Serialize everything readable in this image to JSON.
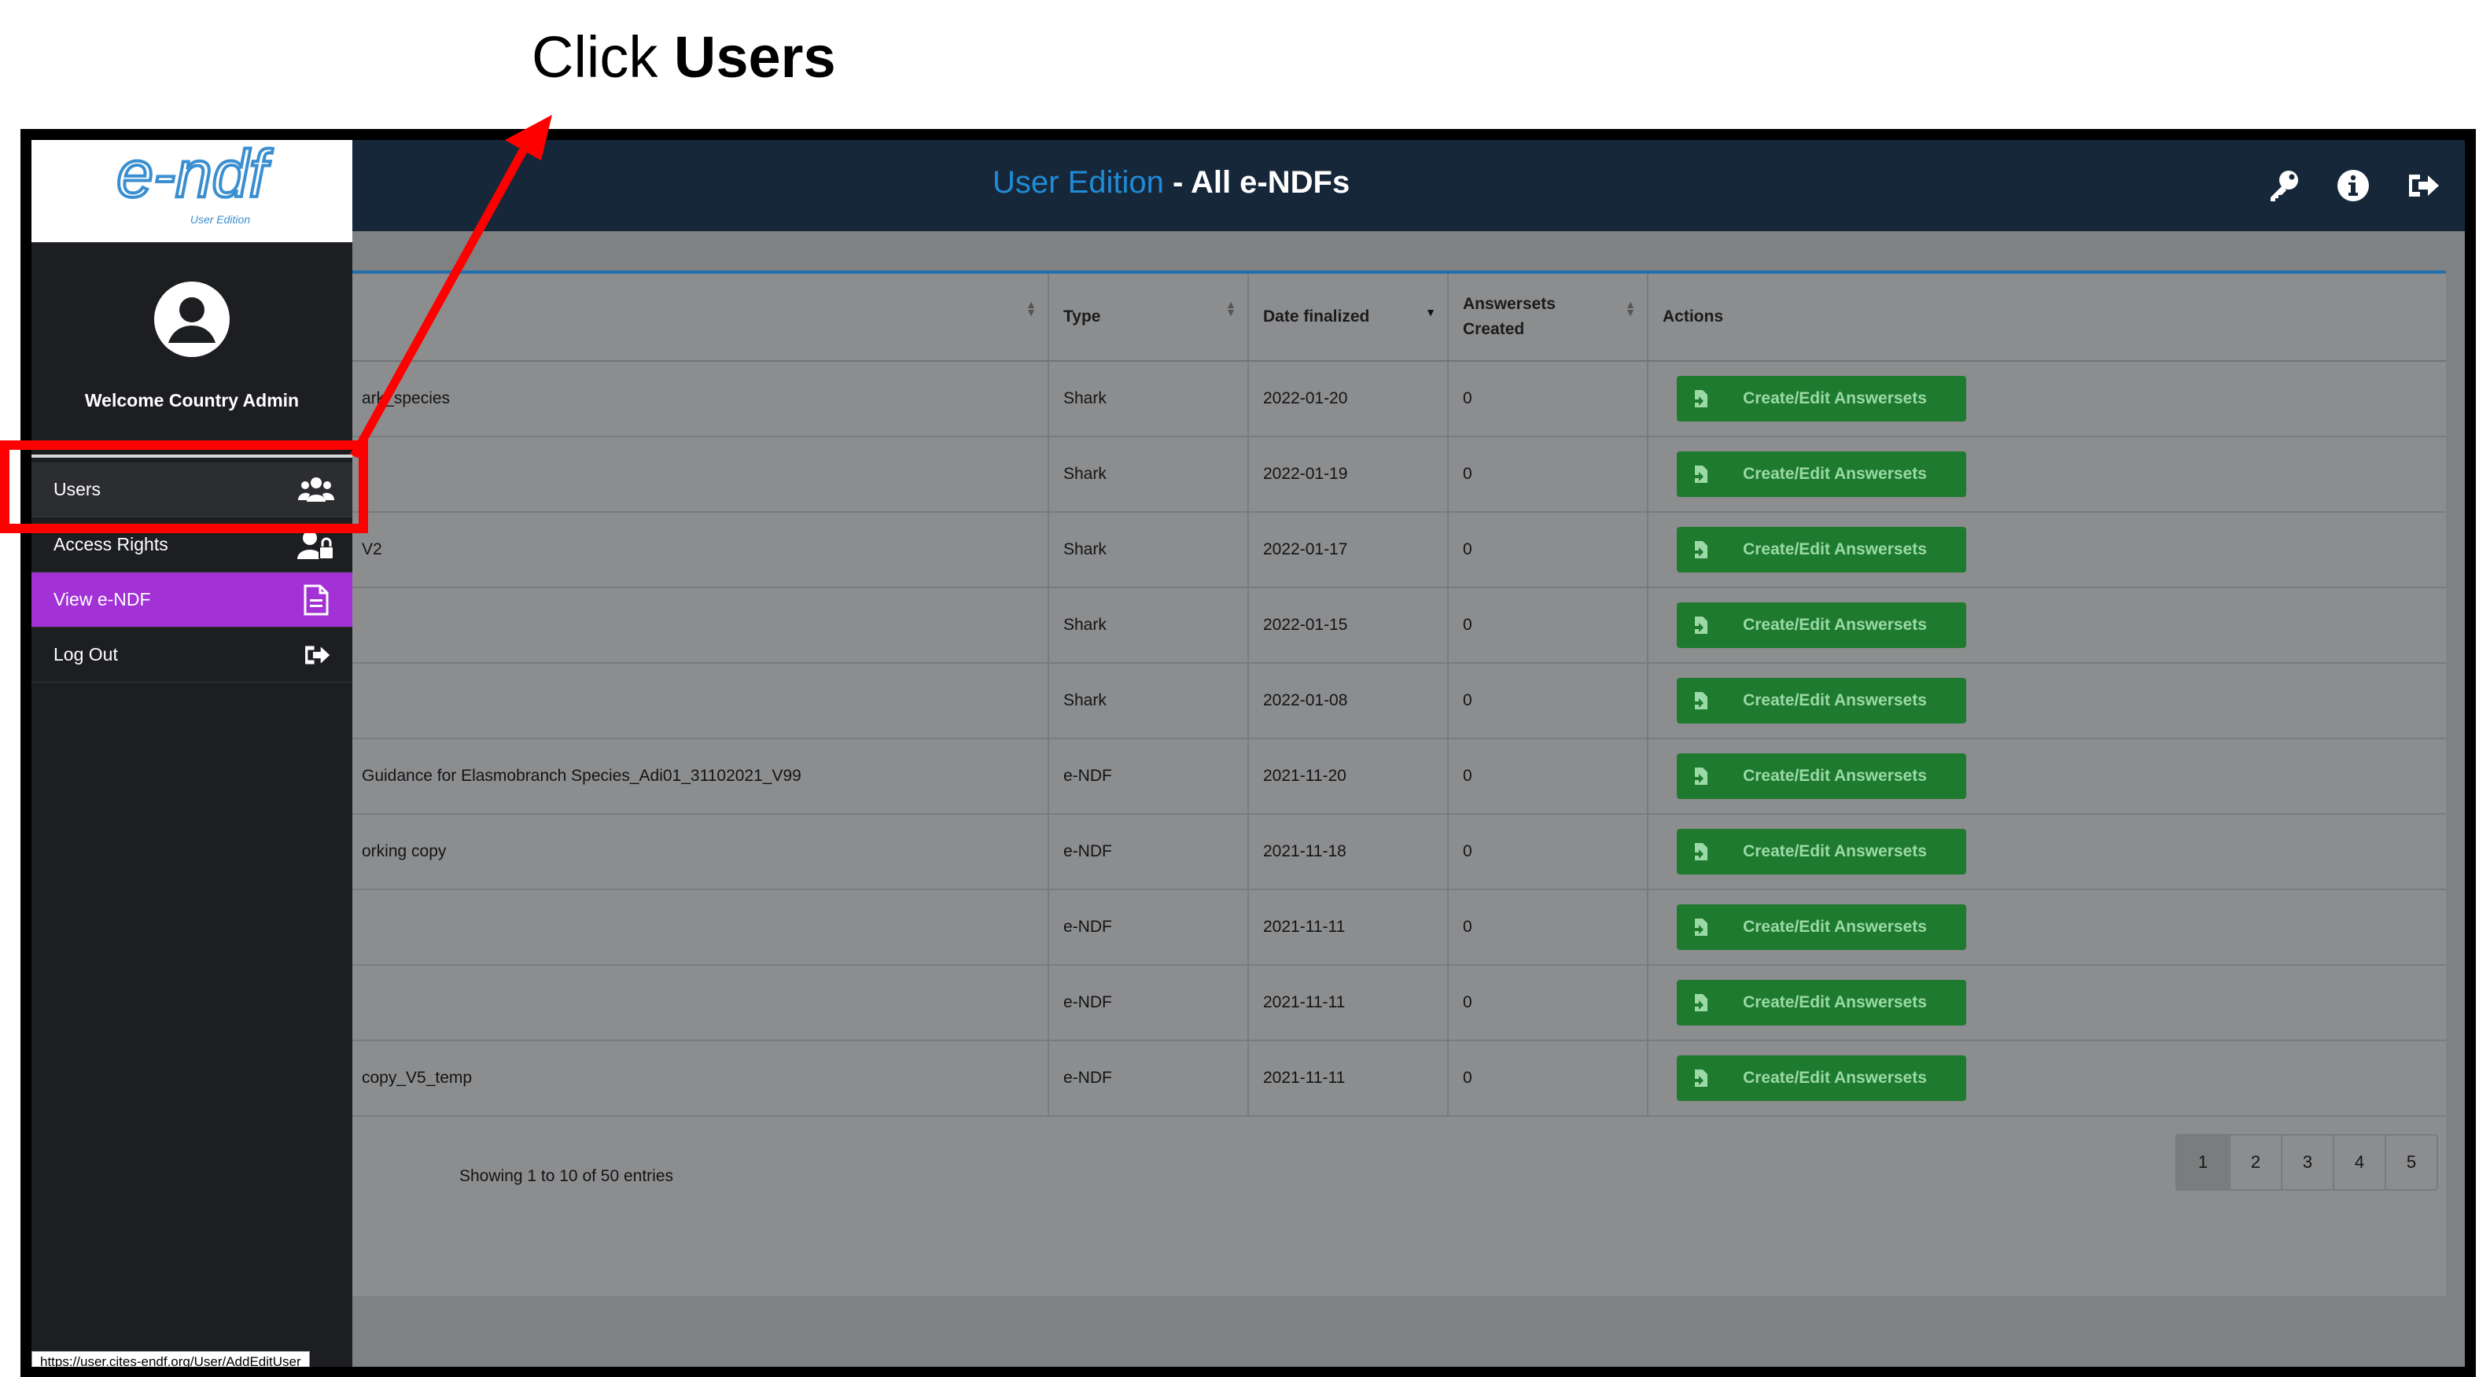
{
  "instruction": {
    "prefix": "Click ",
    "bold": "Users"
  },
  "header": {
    "accent": "User Edition",
    "title": " - All e-NDFs"
  },
  "header_icons": [
    "key-icon",
    "info-icon",
    "logout-icon"
  ],
  "sidebar": {
    "logo_text": "e-ndf",
    "logo_subtitle": "User Edition",
    "welcome": "Welcome Country Admin",
    "items": [
      {
        "label": "Users",
        "icon": "users-icon"
      },
      {
        "label": "Access Rights",
        "icon": "user-lock-icon"
      },
      {
        "label": "View e-NDF",
        "icon": "document-icon"
      },
      {
        "label": "Log Out",
        "icon": "logout-icon"
      }
    ]
  },
  "table": {
    "columns": [
      "Type",
      "Date finalized",
      "Answersets Created",
      "Actions"
    ],
    "action_label": "Create/Edit Answersets",
    "rows": [
      {
        "name": "ark_species",
        "type": "Shark",
        "date": "2022-01-20",
        "count": "0"
      },
      {
        "name": "",
        "type": "Shark",
        "date": "2022-01-19",
        "count": "0"
      },
      {
        "name": "V2",
        "type": "Shark",
        "date": "2022-01-17",
        "count": "0"
      },
      {
        "name": "",
        "type": "Shark",
        "date": "2022-01-15",
        "count": "0"
      },
      {
        "name": "",
        "type": "Shark",
        "date": "2022-01-08",
        "count": "0"
      },
      {
        "name": "Guidance for Elasmobranch Species_Adi01_31102021_V99",
        "type": "e-NDF",
        "date": "2021-11-20",
        "count": "0"
      },
      {
        "name": "orking copy",
        "type": "e-NDF",
        "date": "2021-11-18",
        "count": "0"
      },
      {
        "name": "",
        "type": "e-NDF",
        "date": "2021-11-11",
        "count": "0"
      },
      {
        "name": "",
        "type": "e-NDF",
        "date": "2021-11-11",
        "count": "0"
      },
      {
        "name": "copy_V5_temp",
        "type": "e-NDF",
        "date": "2021-11-11",
        "count": "0"
      }
    ]
  },
  "entries": "Showing 1 to 10 of 50 entries",
  "pages": [
    "1",
    "2",
    "3",
    "4",
    "5"
  ],
  "status_url": "https://user.cites-endf.org/User/AddEditUser",
  "colors": {
    "topbar": "#17273a",
    "accent": "#1f8bd6",
    "button": "#1d7a2e",
    "active_menu": "#a231d6",
    "highlight": "#ff0000"
  }
}
